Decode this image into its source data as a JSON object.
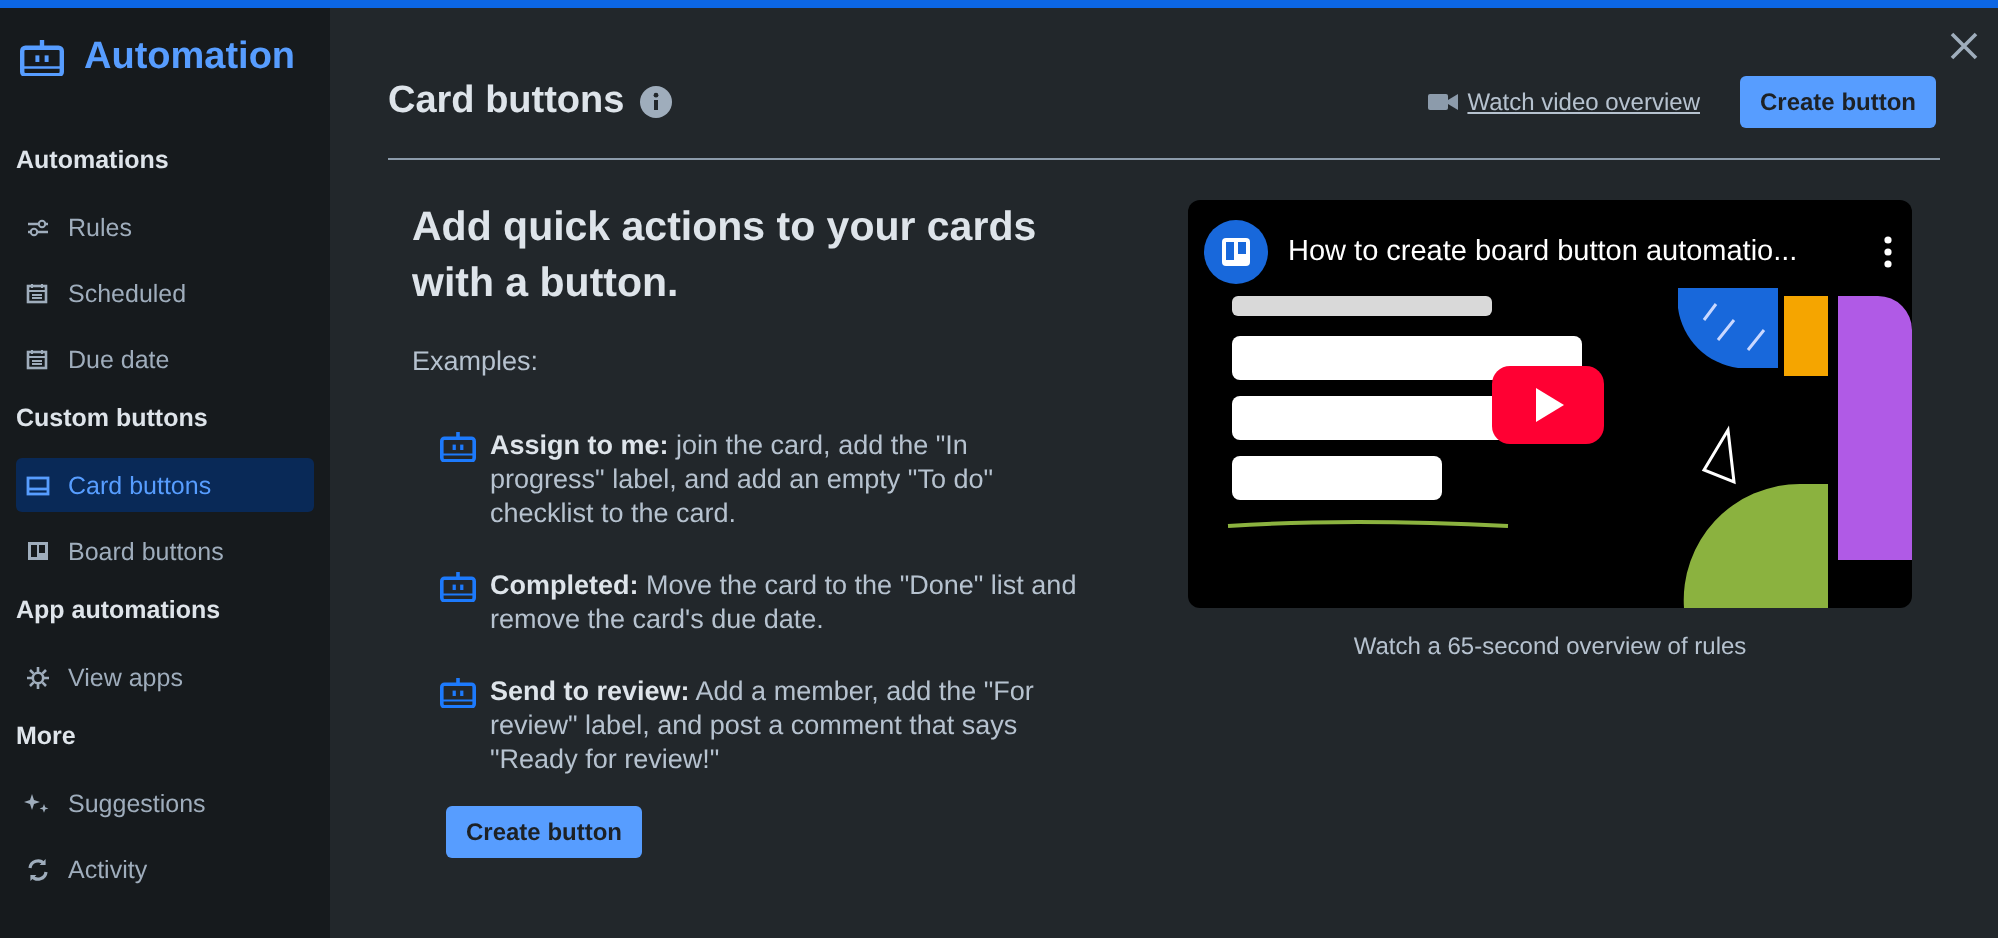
{
  "sidebar": {
    "title": "Automation",
    "sections": [
      {
        "heading": "Automations",
        "items": [
          {
            "label": "Rules",
            "selected": false
          },
          {
            "label": "Scheduled",
            "selected": false
          },
          {
            "label": "Due date",
            "selected": false
          }
        ]
      },
      {
        "heading": "Custom buttons",
        "items": [
          {
            "label": "Card buttons",
            "selected": true
          },
          {
            "label": "Board buttons",
            "selected": false
          }
        ]
      },
      {
        "heading": "App automations",
        "items": [
          {
            "label": "View apps",
            "selected": false
          }
        ]
      },
      {
        "heading": "More",
        "items": [
          {
            "label": "Suggestions",
            "selected": false
          },
          {
            "label": "Activity",
            "selected": false
          }
        ]
      }
    ]
  },
  "header": {
    "title": "Card buttons",
    "video_link": "Watch video overview",
    "button": "Create button"
  },
  "intro": {
    "heading": "Add quick actions to your cards with a button.",
    "examples_label": "Examples:",
    "examples": [
      {
        "text": "**Assign to me:** join the card, add the \"In progress\" label, and add an empty \"To do\" checklist to the card."
      },
      {
        "text": "**Completed:** Move the card to the \"Done\" list and remove the card's due date."
      },
      {
        "text": "**Send to review:** Add a member, add the \"For review\" label, and post a comment that says \"Ready for review!\""
      }
    ],
    "button": "Create button"
  },
  "video": {
    "kind": "picture",
    "title": "How to create board button automatio...",
    "caption": "Watch a 65-second overview of rules"
  }
}
